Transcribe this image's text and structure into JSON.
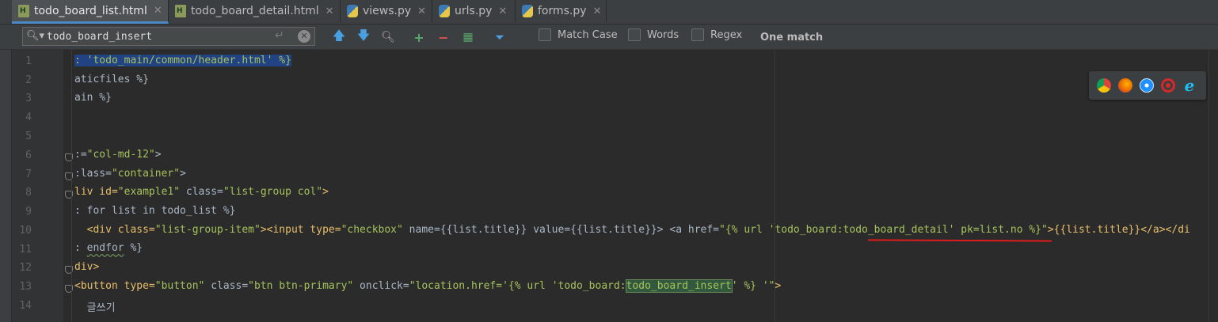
{
  "tabs": [
    {
      "label": "todo_board_list.html",
      "type": "html",
      "active": true
    },
    {
      "label": "todo_board_detail.html",
      "type": "html",
      "active": false
    },
    {
      "label": "views.py",
      "type": "py",
      "active": false
    },
    {
      "label": "urls.py",
      "type": "py",
      "active": false
    },
    {
      "label": "forms.py",
      "type": "py",
      "active": false
    }
  ],
  "search": {
    "value": "todo_board_insert",
    "match_case_label": "Match Case",
    "words_label": "Words",
    "regex_label": "Regex",
    "status": "One match"
  },
  "icons": {
    "prev": "arrow-up-icon",
    "next": "arrow-down-icon",
    "find_all": "find-all-icon",
    "add_selection": "add-occurrence-icon",
    "remove_selection": "remove-occurrence-icon",
    "select_all": "select-all-occurrences-icon",
    "filter": "filter-icon"
  },
  "browser_icons": [
    "chrome-icon",
    "firefox-icon",
    "safari-icon",
    "opera-icon",
    "ie-icon"
  ],
  "line_numbers": [
    "1",
    "2",
    "3",
    "4",
    "5",
    "6",
    "7",
    "8",
    "9",
    "10",
    "11",
    "12",
    "13",
    "14"
  ],
  "code_lines": {
    "l1": ": 'todo_main/common/header.html' %}",
    "l2": "aticfiles %}",
    "l3": "ain %}",
    "l6a": ":=",
    "l6b": "\"col-md-12\"",
    "l6c": ">",
    "l7a": ":lass=",
    "l7b": "\"container\"",
    "l7c": ">",
    "l8a": "liv id=",
    "l8b": "\"example1\"",
    "l8c": " class=",
    "l8d": "\"list-group col\"",
    "l8e": ">",
    "l9": ": for list in todo_list %}",
    "l10a": "  <div class=",
    "l10b": "\"list-group-item\"",
    "l10c": "><input type=",
    "l10d": "\"checkbox\"",
    "l10e": " name={{list.title}} value={{list.title}}> <a href=",
    "l10f": "\"{% url 'todo_board:todo_board_detail' pk=list.no %}\"",
    "l10g": ">{{list.title}}</a></di",
    "l11a": ": ",
    "l11b": "endfor",
    "l11c": " %}",
    "l12": "div>",
    "l13a": "<button type=",
    "l13b": "\"button\"",
    "l13c": " class=",
    "l13d": "\"btn btn-primary\"",
    "l13e": " onclick=",
    "l13f": "\"location.href='{% url 'todo_board:",
    "l13g": "todo_board_insert",
    "l13h": "' %} '\"",
    "l13i": ">",
    "l14": "  글쓰기"
  }
}
